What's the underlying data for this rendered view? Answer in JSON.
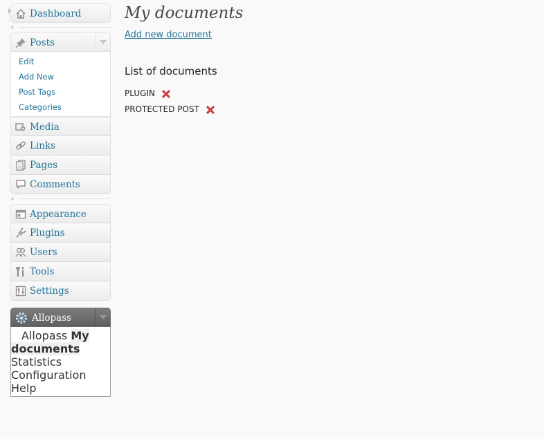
{
  "menu": {
    "dashboard": "Dashboard",
    "posts": {
      "label": "Posts",
      "items": [
        "Edit",
        "Add New",
        "Post Tags",
        "Categories"
      ]
    },
    "group1": [
      "Media",
      "Links",
      "Pages",
      "Comments"
    ],
    "group2": [
      "Appearance",
      "Plugins",
      "Users",
      "Tools",
      "Settings"
    ],
    "allopass": {
      "label": "Allopass",
      "items": [
        "Allopass",
        "My documents",
        "Statistics",
        "Configuration",
        "Help"
      ],
      "current": "My documents"
    },
    "collapse_glyph": "«"
  },
  "content": {
    "title": "My documents",
    "add_link": "Add new document",
    "list_title": "List of documents",
    "documents": [
      "PLUGIN",
      "PROTECTED POST"
    ]
  },
  "colors": {
    "link": "#21759b",
    "delete_icon": "#c21a1a",
    "dark_menu": "#6d6d6d"
  }
}
